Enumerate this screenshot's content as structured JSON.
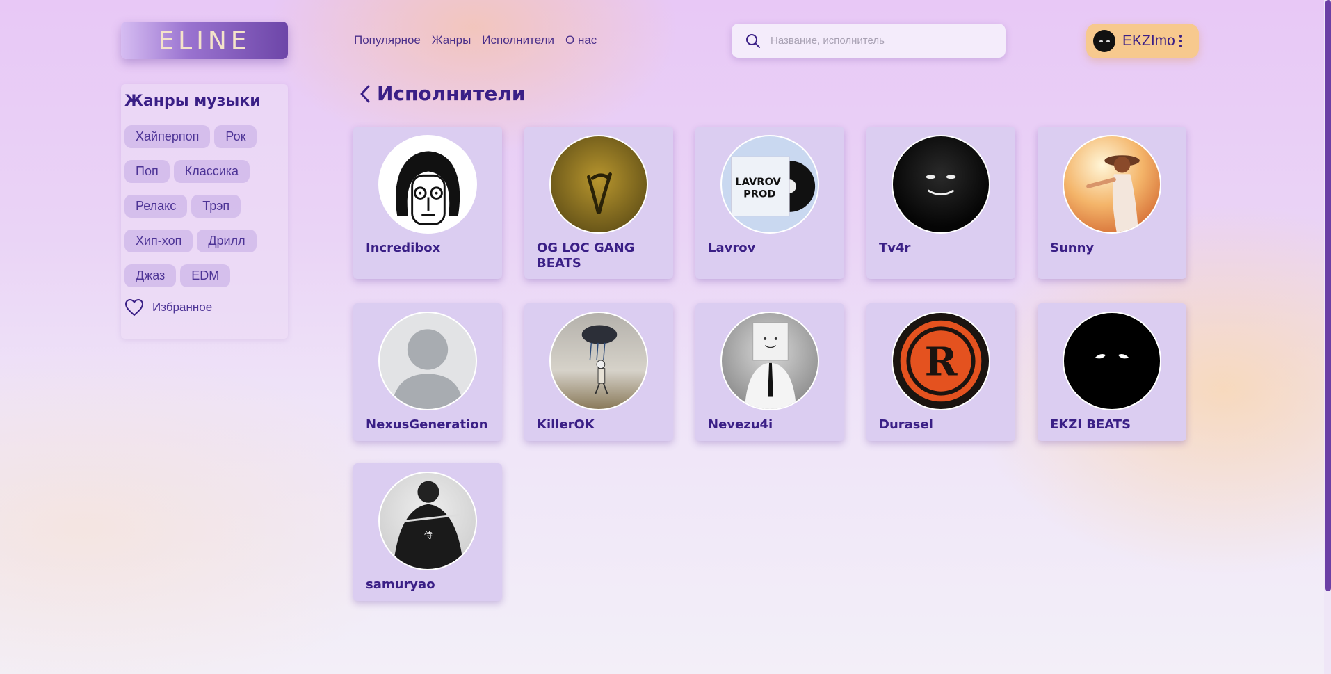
{
  "header": {
    "logo_text": "ELINE",
    "nav": [
      "Популярное",
      "Жанры",
      "Исполнители",
      "О нас"
    ],
    "search_placeholder": "Название, исполнитель",
    "user_name": "EKZImo"
  },
  "sidebar": {
    "title": "Жанры музыки",
    "genres": [
      "Хайперпоп",
      "Рок",
      "Поп",
      "Классика",
      "Релакс",
      "Трэп",
      "Хип-хоп",
      "Дрилл",
      "Джаз",
      "EDM"
    ],
    "favorites_label": "Избранное"
  },
  "main": {
    "title": "Исполнители",
    "artists": [
      {
        "name": "Incredibox"
      },
      {
        "name": "OG LOC GANG BEATS"
      },
      {
        "name": "Lavrov"
      },
      {
        "name": "Tv4r"
      },
      {
        "name": "Sunny"
      },
      {
        "name": "NexusGeneration"
      },
      {
        "name": "KillerOK"
      },
      {
        "name": "Nevezu4i"
      },
      {
        "name": "Durasel"
      },
      {
        "name": "EKZI BEATS"
      },
      {
        "name": "samuryao"
      }
    ]
  },
  "colors": {
    "accent": "#3a1f86",
    "card": "#dbcdf1",
    "user_badge": "#f7c98e"
  }
}
